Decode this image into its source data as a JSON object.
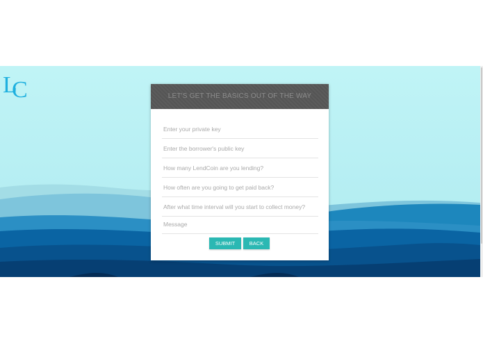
{
  "brand": {
    "logo_text": "LC",
    "logo_color": "#1fb0df"
  },
  "form": {
    "title": "LET'S GET THE BASICS OUT OF THE WAY",
    "fields": [
      {
        "placeholder": "Enter your private key"
      },
      {
        "placeholder": "Enter the borrower's public key"
      },
      {
        "placeholder": "How many LendCoin are you lending?"
      },
      {
        "placeholder": "How often are you going to get paid back?"
      },
      {
        "placeholder": "After what time interval will you start to collect money?"
      },
      {
        "placeholder": "Message"
      }
    ],
    "submit_label": "SUBMIT",
    "back_label": "BACK"
  },
  "colors": {
    "sky": "#c2f4f5",
    "header_bg": "#555555",
    "button": "#2bb8b3",
    "mountain_dark": "#0a3f78"
  }
}
